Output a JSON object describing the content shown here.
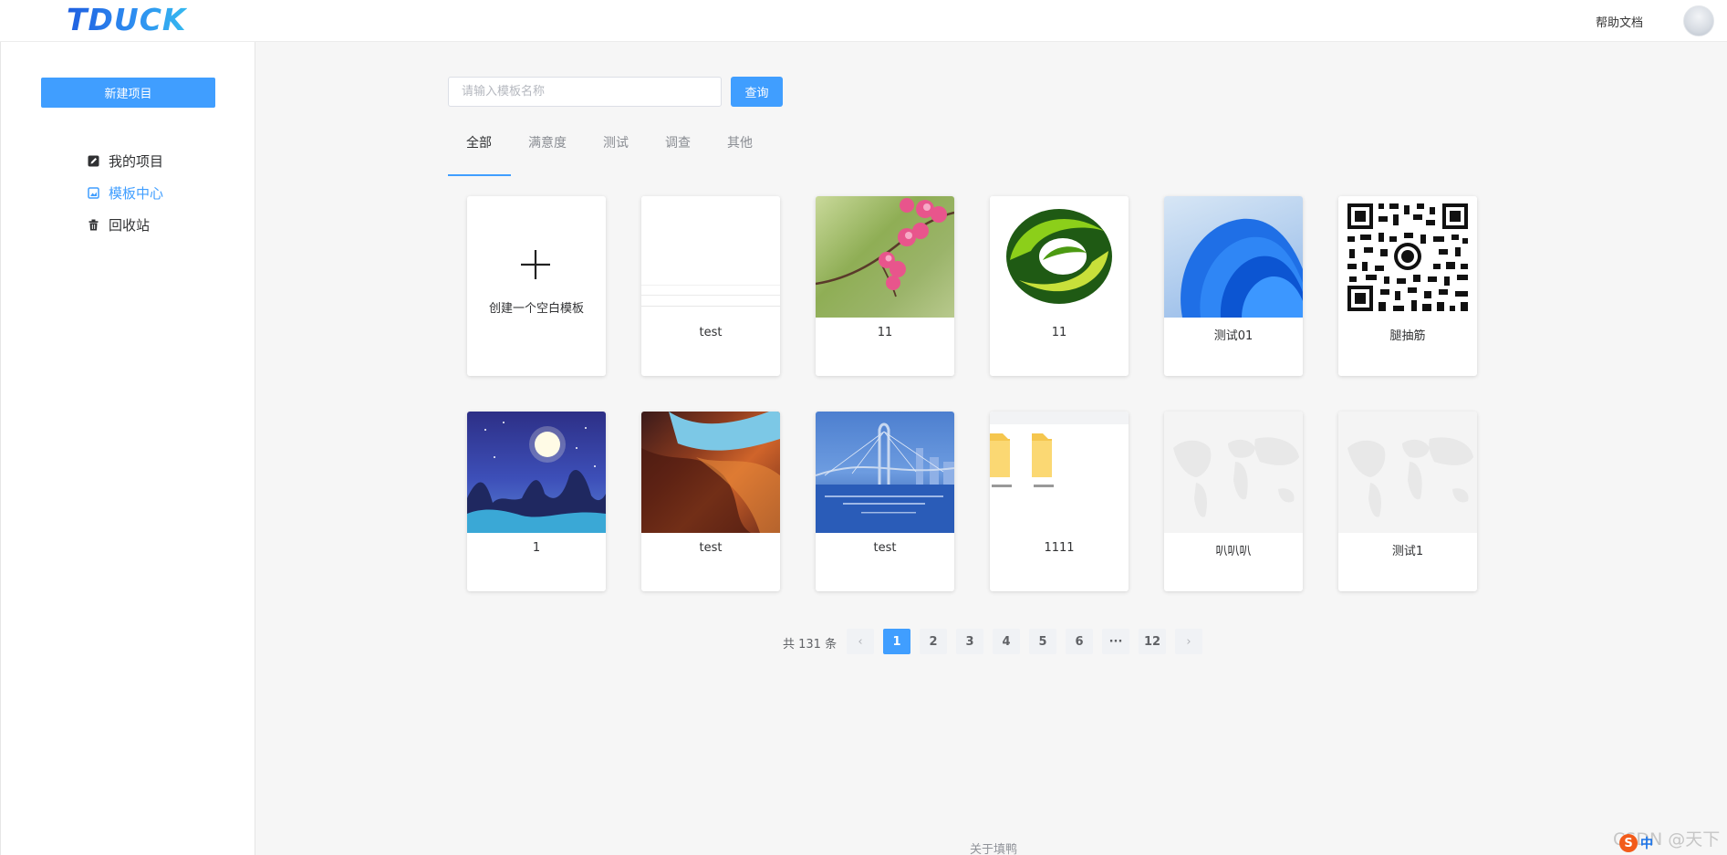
{
  "header": {
    "logo": "TDUCK",
    "help_link": "帮助文档"
  },
  "sidebar": {
    "new_project": "新建项目",
    "items": [
      {
        "label": "我的项目",
        "icon": "edit-icon"
      },
      {
        "label": "模板中心",
        "icon": "image-icon",
        "active": true
      },
      {
        "label": "回收站",
        "icon": "trash-icon"
      }
    ]
  },
  "search": {
    "placeholder": "请输入模板名称",
    "value": "",
    "button": "查询"
  },
  "tabs": [
    "全部",
    "满意度",
    "测试",
    "调查",
    "其他"
  ],
  "templates": {
    "blank_label": "创建一个空白模板",
    "cards": [
      {
        "label": "test",
        "thumb": "blank-form-thumbnail"
      },
      {
        "label": "11",
        "thumb": "pink-blossom-photo"
      },
      {
        "label": "11",
        "thumb": "green-logo-image"
      },
      {
        "label": "测试01",
        "thumb": "blue-abstract-wallpaper"
      },
      {
        "label": "腿抽筋",
        "thumb": "qr-code-image"
      },
      {
        "label": "1",
        "thumb": "moon-night-illustration"
      },
      {
        "label": "test",
        "thumb": "canyon-photo"
      },
      {
        "label": "test",
        "thumb": "bridge-photo"
      },
      {
        "label": "1111",
        "thumb": "folders-screenshot"
      },
      {
        "label": "叭叭叭",
        "thumb": "world-map-background"
      },
      {
        "label": "测试1",
        "thumb": "world-map-background"
      }
    ]
  },
  "pagination": {
    "total_text": "共 131 条",
    "pages": [
      "1",
      "2",
      "3",
      "4",
      "5",
      "6",
      "···",
      "12"
    ],
    "current": "1",
    "prev": "‹",
    "next": "›"
  },
  "footer": {
    "about": "关于填鸭"
  },
  "overlay": {
    "watermark": "CSDN @天下",
    "ime_badge": "S",
    "ime_mode": "中"
  }
}
